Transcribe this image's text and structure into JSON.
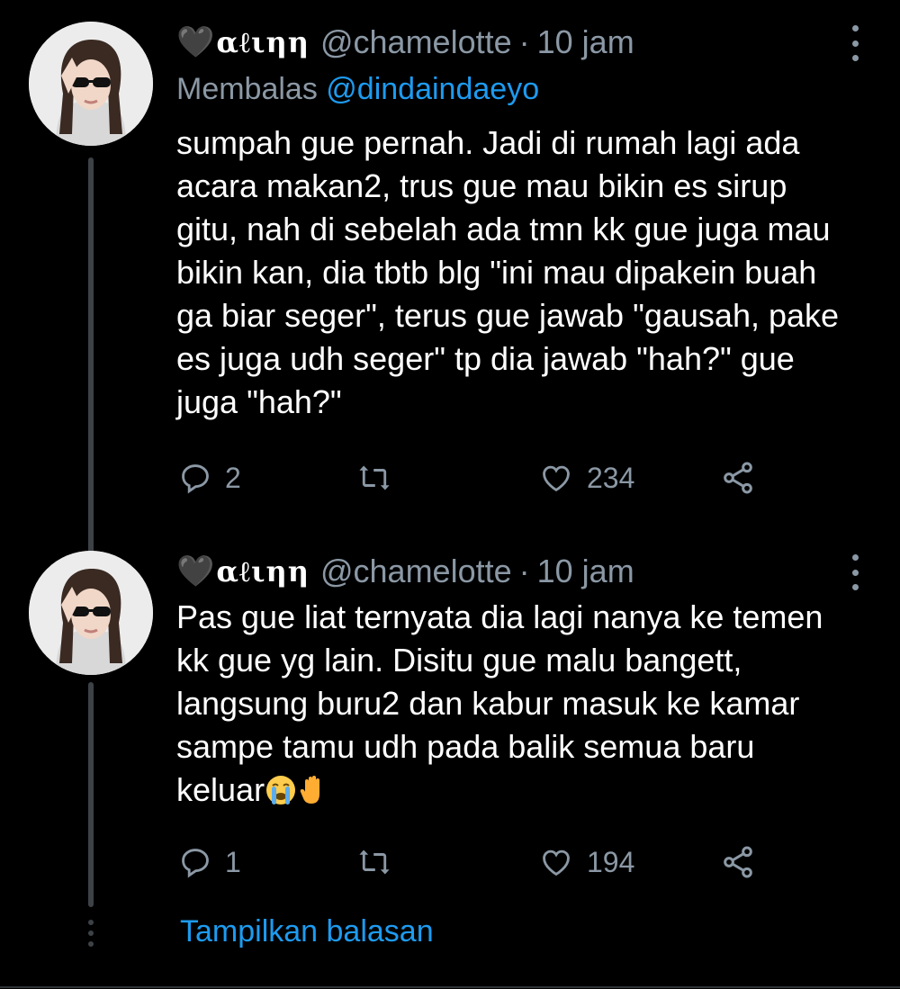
{
  "tweets": [
    {
      "display_name": "αℓιηη",
      "heart": "🖤",
      "handle": "@chamelotte",
      "dot": "·",
      "time": "10 jam",
      "replying_prefix": "Membalas",
      "replying_mention": "@dindaindaeyo",
      "lines": [
        "sumpah gue pernah. Jadi di rumah lagi ada",
        "acara makan2, trus gue mau bikin es sirup",
        "gitu, nah di sebelah ada tmn kk gue juga mau",
        "bikin kan, dia tbtb blg \"ini mau dipakein buah",
        "ga biar seger\", terus gue jawab \"gausah, pake",
        "es juga udh seger\" tp dia jawab \"hah?\" gue",
        "juga \"hah?\""
      ],
      "replies": "2",
      "retweets": "",
      "likes": "234"
    },
    {
      "display_name": "αℓιηη",
      "heart": "🖤",
      "handle": "@chamelotte",
      "dot": "·",
      "time": "10 jam",
      "lines": [
        "Pas gue liat ternyata dia lagi nanya ke temen",
        "kk gue yg lain. Disitu gue malu bangett,",
        "langsung buru2 dan kabur masuk ke kamar",
        "sampe tamu udh pada balik semua baru",
        "keluar"
      ],
      "trailing_emojis": [
        "loudly-crying-face",
        "raised-hand"
      ],
      "replies": "1",
      "retweets": "",
      "likes": "194"
    }
  ],
  "show_replies": "Tampilkan balasan",
  "colors": {
    "background": "#000000",
    "text": "#ffffff",
    "secondary": "#8b98a5",
    "link": "#1d9bf0",
    "thread_line": "#3d4247"
  },
  "icons": {
    "reply": "reply-icon",
    "retweet": "retweet-icon",
    "like": "heart-outline-icon",
    "share": "share-icon",
    "more": "more-vertical-icon"
  }
}
